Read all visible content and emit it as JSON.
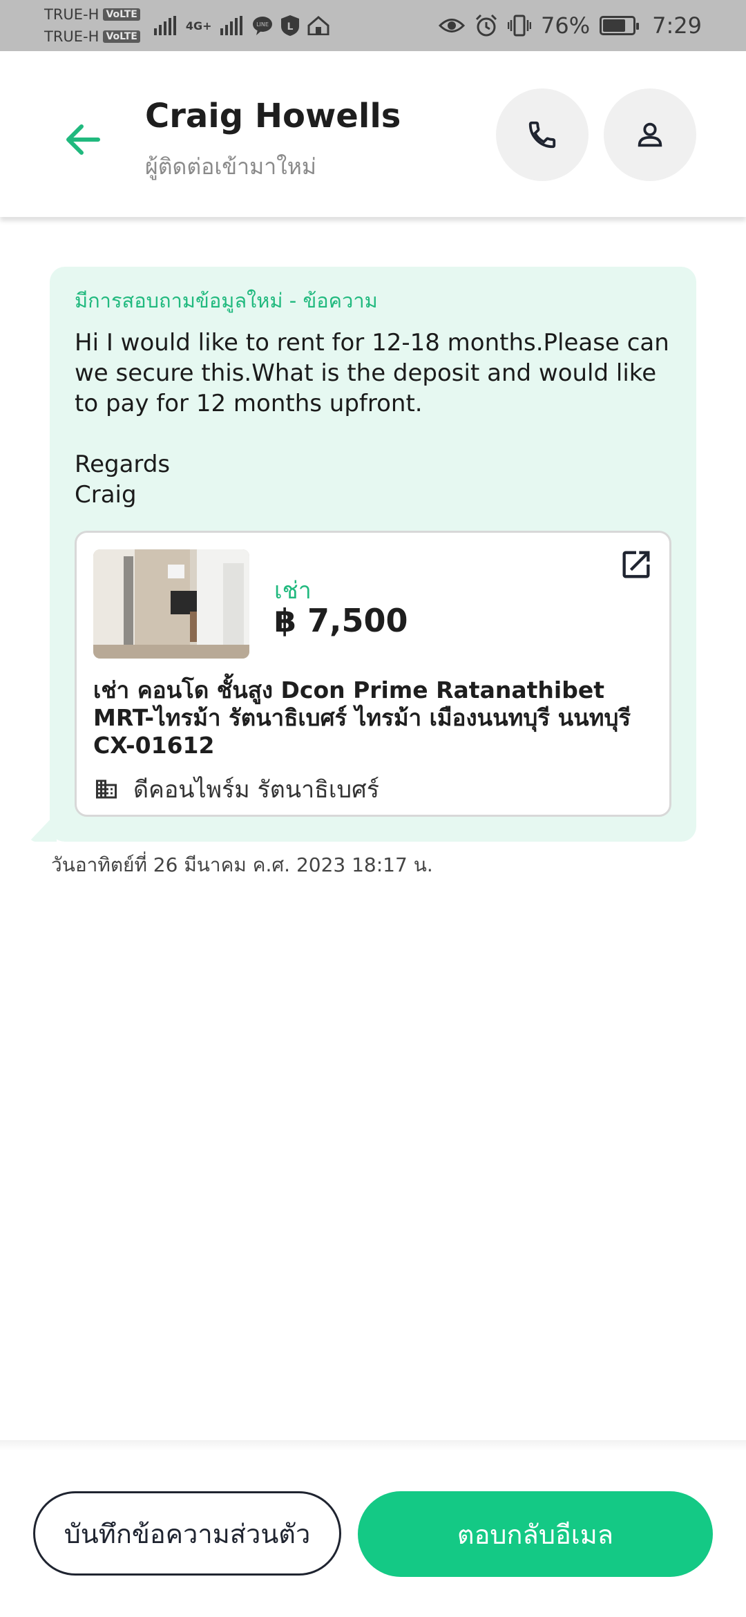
{
  "status_bar": {
    "carrier_1": "TRUE-H",
    "carrier_2": "TRUE-H",
    "volte": "VoLTE",
    "network": "4G+",
    "battery_percent": "76%",
    "battery_level": 0.76,
    "time": "7:29",
    "icons": [
      "signal-icon",
      "line-app-icon",
      "l-app-icon",
      "home-app-icon",
      "eye-icon",
      "alarm-icon",
      "vibrate-icon",
      "battery-icon"
    ]
  },
  "header": {
    "name": "Craig Howells",
    "subtitle": "ผู้ติดต่อเข้ามาใหม่",
    "accent_color": "#20b97e"
  },
  "message": {
    "title": "มีการสอบถามข้อมูลใหม่ - ข้อความ",
    "body": "Hi I would like to rent for 12-18 months.Please can we secure this.What is the deposit and would like to pay for 12 months upfront.\n\nRegards\nCraig",
    "listing": {
      "deal_type": "เช่า",
      "price": "฿ 7,500",
      "title": "เช่า คอนโด ชั้นสูง Dcon Prime Ratanathibet MRT-ไทรม้า รัตนาธิเบศร์ ไทรม้า เมืองนนทบุรี นนทบุรี CX-01612",
      "building": "ดีคอนไพร์ม รัตนาธิเบศร์"
    },
    "timestamp": "วันอาทิตย์ที่ 26 มีนาคม ค.ศ. 2023 18:17 น."
  },
  "actions": {
    "note_label": "บันทึกข้อความส่วนตัว",
    "reply_label": "ตอบกลับอีเมล",
    "reply_color": "#14c985"
  }
}
